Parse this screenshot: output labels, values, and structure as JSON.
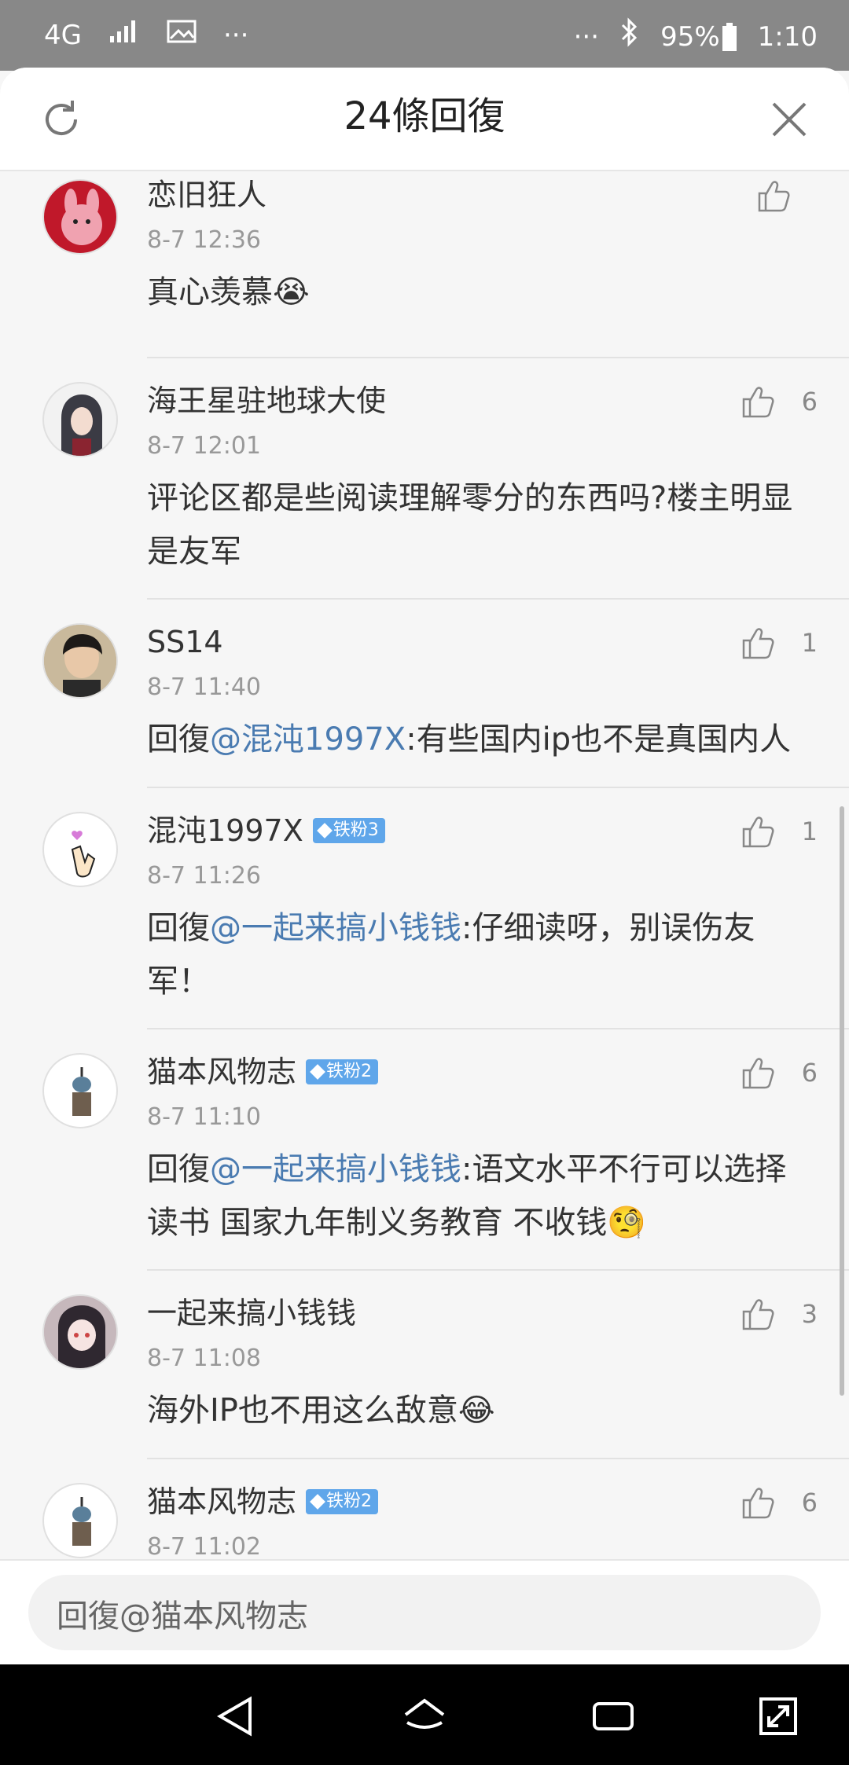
{
  "status_bar": {
    "network": "4G",
    "battery": "95%",
    "time": "1:10"
  },
  "header": {
    "title": "24條回復",
    "refresh_icon": "refresh-icon",
    "close_icon": "close-icon"
  },
  "comments": [
    {
      "name": "恋旧狂人",
      "badge": "",
      "time": "8-7 12:36",
      "text_prefix": "",
      "mention": "",
      "text": "真心羡慕😭",
      "likes": ""
    },
    {
      "name": "海王星驻地球大使",
      "badge": "",
      "time": "8-7 12:01",
      "text_prefix": "",
      "mention": "",
      "text": "评论区都是些阅读理解零分的东西吗?楼主明显是友军",
      "likes": "6"
    },
    {
      "name": "SS14",
      "badge": "",
      "time": "8-7 11:40",
      "text_prefix": "回復",
      "mention": "@混沌1997X",
      "text": ":有些国内ip也不是真国内人",
      "likes": "1"
    },
    {
      "name": "混沌1997X",
      "badge": "铁粉3",
      "time": "8-7 11:26",
      "text_prefix": "回復",
      "mention": "@一起来搞小钱钱",
      "text": ":仔细读呀，别误伤友军！",
      "likes": "1"
    },
    {
      "name": "猫本风物志",
      "badge": "铁粉2",
      "time": "8-7 11:10",
      "text_prefix": "回復",
      "mention": "@一起来搞小钱钱",
      "text": ":语文水平不行可以选择读书 国家九年制义务教育 不收钱🧐",
      "likes": "6"
    },
    {
      "name": "一起来搞小钱钱",
      "badge": "",
      "time": "8-7 11:08",
      "text_prefix": "",
      "mention": "",
      "text": "海外IP也不用这么敌意😂",
      "likes": "3"
    },
    {
      "name": "猫本风物志",
      "badge": "铁粉2",
      "time": "8-7 11:02",
      "text_prefix": "",
      "mention": "",
      "text": "",
      "likes": "6"
    }
  ],
  "input": {
    "placeholder": "回復@猫本风物志"
  },
  "colors": {
    "mention": "#4a7bb1",
    "badge": "#5fa6ea",
    "statusbar": "#888888"
  }
}
